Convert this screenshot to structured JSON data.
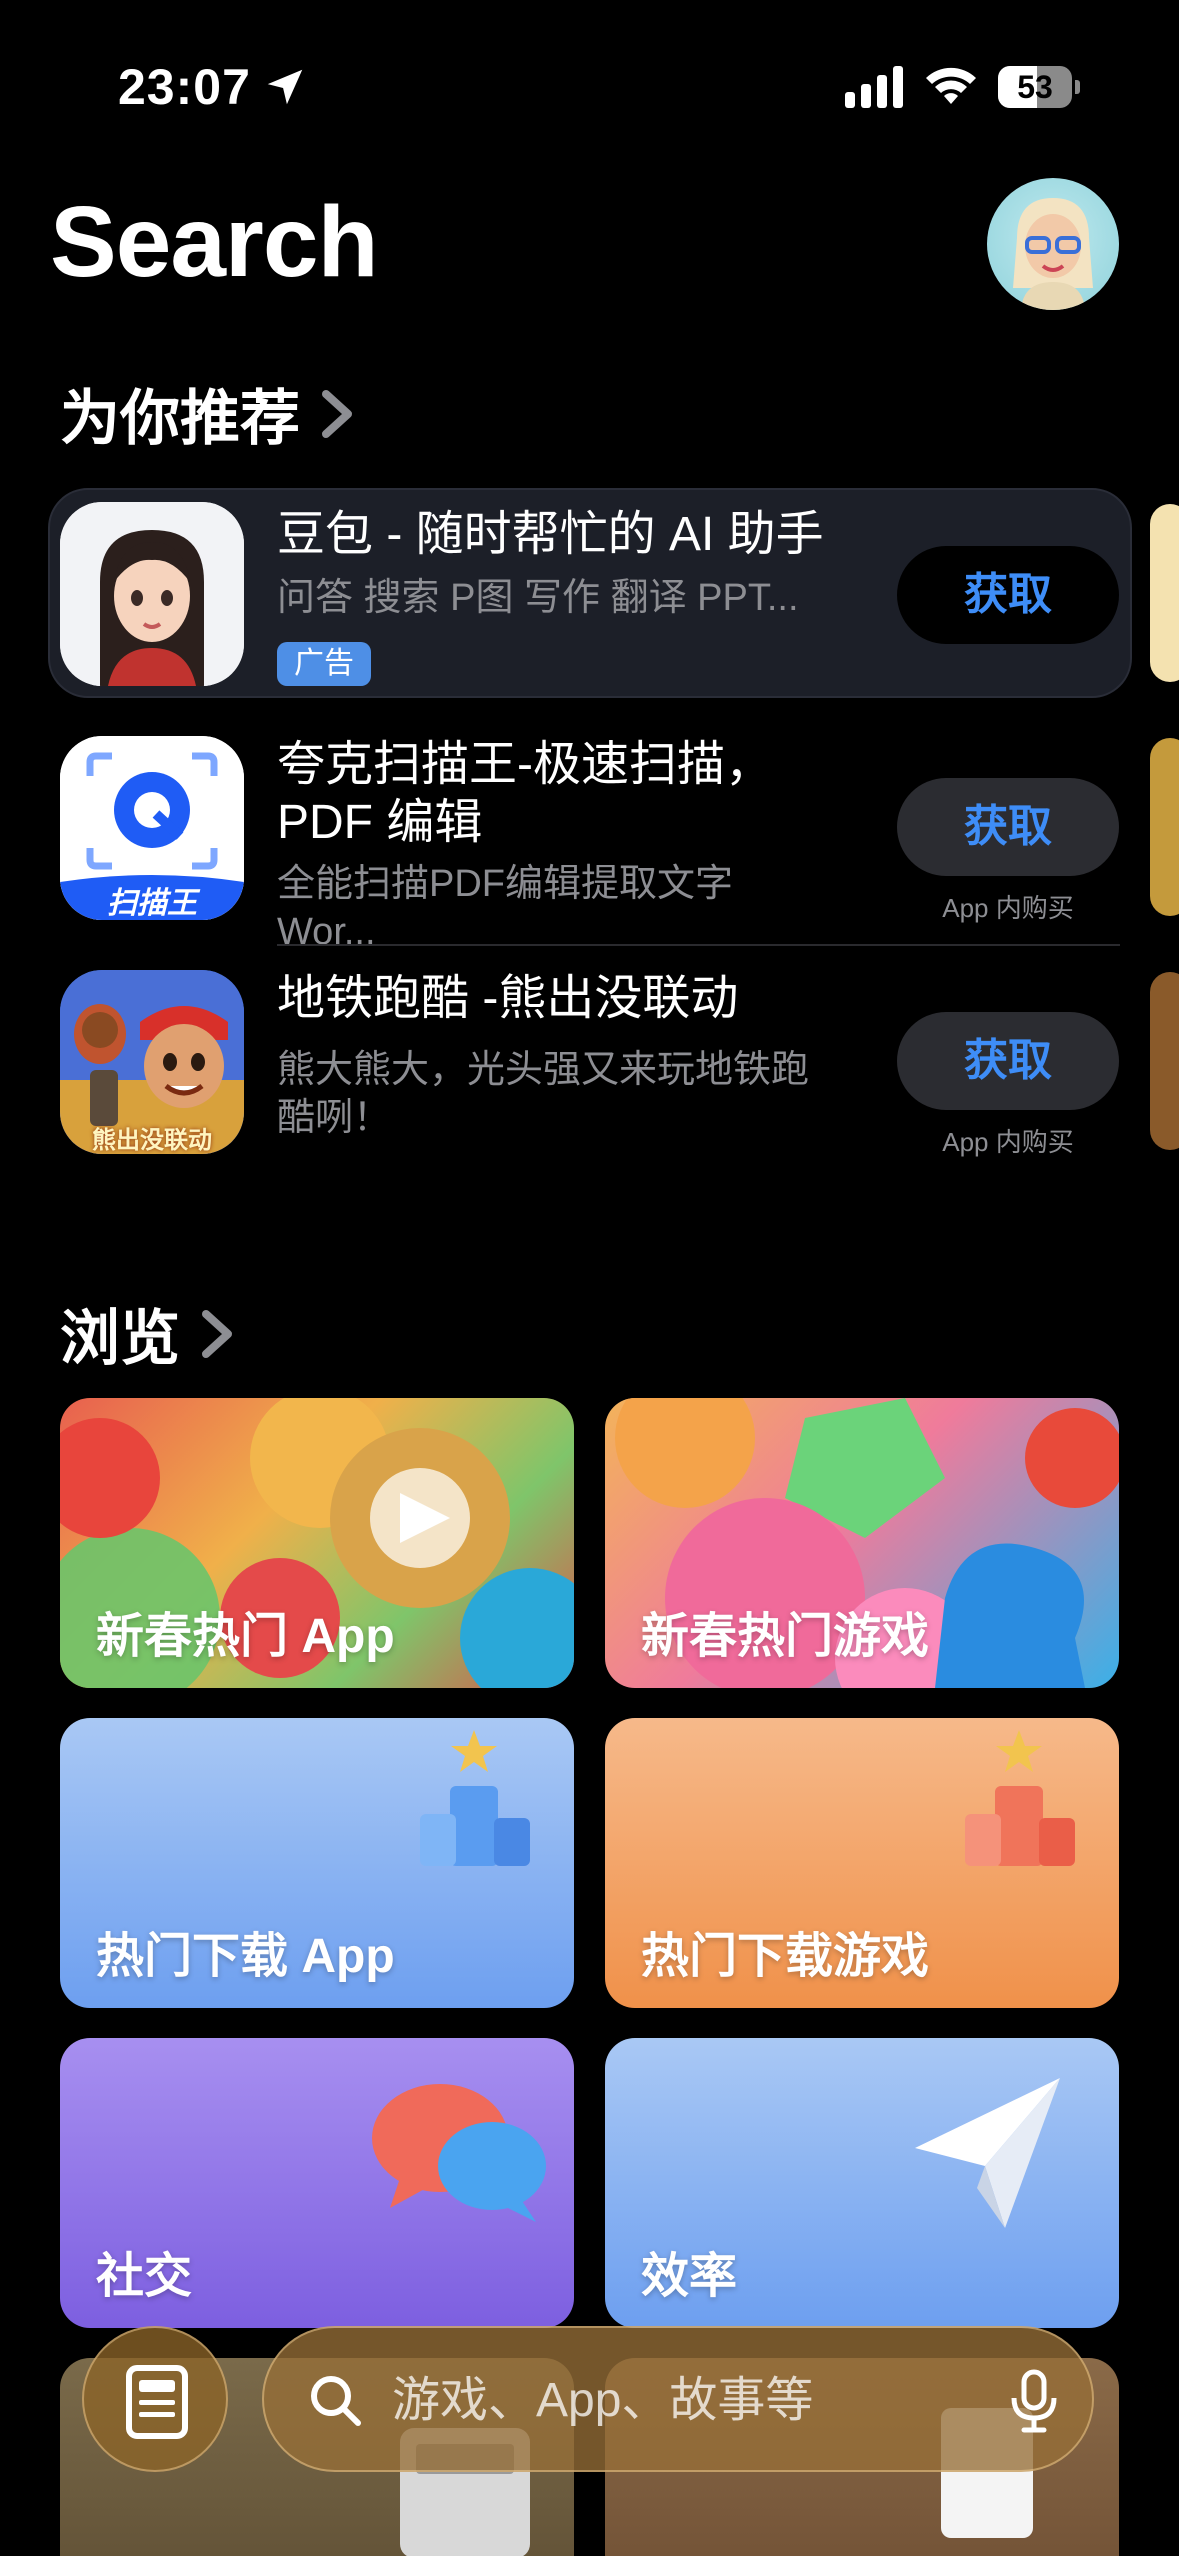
{
  "status_bar": {
    "time": "23:07",
    "battery": "53",
    "battery_level": 0.53
  },
  "header": {
    "title": "Search"
  },
  "recommended": {
    "title": "为你推荐",
    "apps": [
      {
        "name": "豆包 - 随时帮忙的 AI 助手",
        "subtitle": "问答 搜索 P图 写作 翻译 PPT...",
        "badge": "广告",
        "button": "获取",
        "note": ""
      },
      {
        "name_line1": "夸克扫描王-极速扫描，",
        "name_line2": "PDF 编辑",
        "subtitle": "全能扫描PDF编辑提取文字 Wor...",
        "button": "获取",
        "note": "App 内购买",
        "icon_text": "扫描王"
      },
      {
        "name": "地铁跑酷 -熊出没联动",
        "subtitle_line1": "熊大熊大，光头强又来玩地铁跑",
        "subtitle_line2": "酷咧！",
        "button": "获取",
        "note": "App 内购买",
        "icon_text": "熊出没联动"
      }
    ]
  },
  "browse": {
    "title": "浏览",
    "tiles": [
      {
        "label": "新春热门 App"
      },
      {
        "label": "新春热门游戏"
      },
      {
        "label": "热门下载 App"
      },
      {
        "label": "热门下载游戏"
      },
      {
        "label": "社交"
      },
      {
        "label": "效率"
      }
    ]
  },
  "search": {
    "placeholder": "游戏、App、故事等"
  },
  "colors": {
    "accent": "#3e8df7",
    "background": "#000000",
    "card": "#1c1f28"
  }
}
